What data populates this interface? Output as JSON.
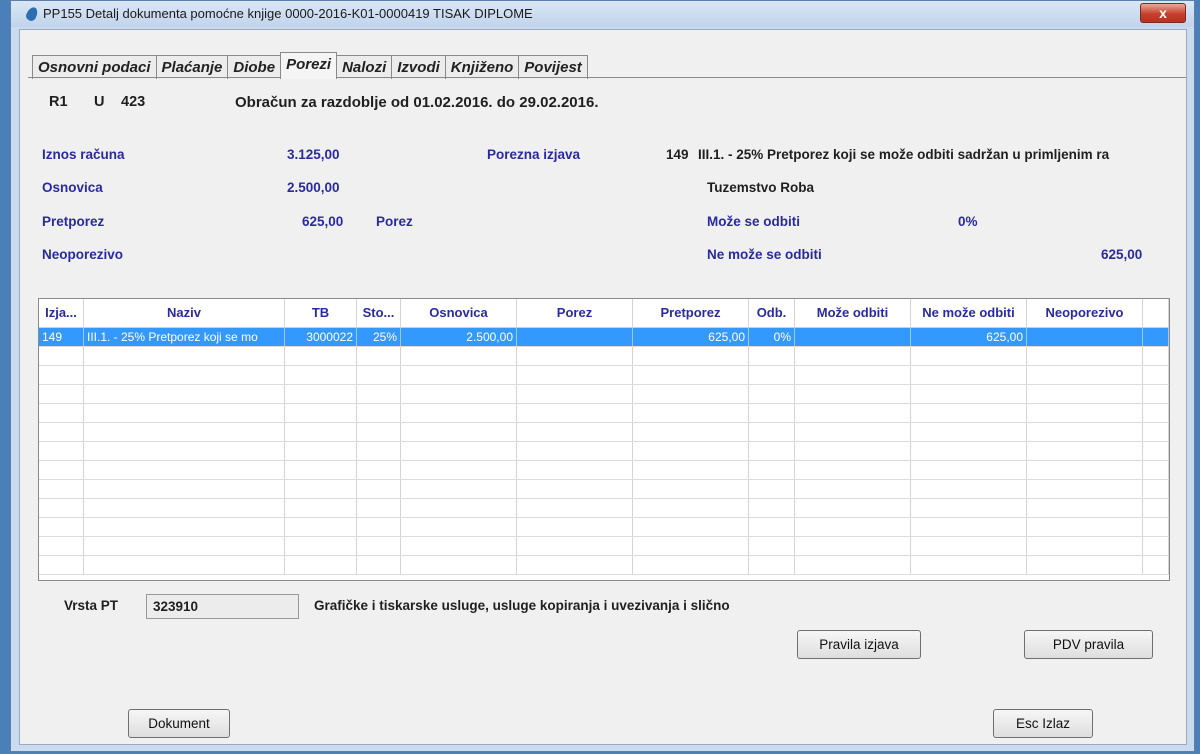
{
  "window": {
    "title": "PP155 Detalj dokumenta pomoćne knjige 0000-2016-K01-0000419 TISAK DIPLOME",
    "close_label": "x"
  },
  "tabs": [
    {
      "label": "Osnovni podaci"
    },
    {
      "label": "Plaćanje"
    },
    {
      "label": "Diobe"
    },
    {
      "label": "Porezi",
      "active": true
    },
    {
      "label": "Nalozi"
    },
    {
      "label": "Izvodi"
    },
    {
      "label": "Knjiženo"
    },
    {
      "label": "Povijest"
    }
  ],
  "header": {
    "code1": "R1",
    "code2": "U",
    "code3": "423",
    "period": "Obračun za razdoblje od 01.02.2016. do 29.02.2016."
  },
  "summary": {
    "iznos_label": "Iznos računa",
    "iznos_value": "3.125,00",
    "osnovica_label": "Osnovica",
    "osnovica_value": "2.500,00",
    "pretporez_label": "Pretporez",
    "pretporez_value": "625,00",
    "porez_label": "Porez",
    "neoporezivo_label": "Neoporezivo",
    "porezna_izjava_label": "Porezna izjava",
    "porezna_izjava_code": "149",
    "porezna_izjava_text": "III.1. - 25% Pretporez koji se može odbiti sadržan u primljenim ra",
    "tuzemstvo": "Tuzemstvo Roba",
    "moze_label": "Može se odbiti",
    "moze_value": "0%",
    "ne_moze_label": "Ne može se odbiti",
    "ne_moze_value": "625,00"
  },
  "grid": {
    "columns": [
      "Izja...",
      "Naziv",
      "TB",
      "Sto...",
      "Osnovica",
      "Porez",
      "Pretporez",
      "Odb.",
      "Može odbiti",
      "Ne može odbiti",
      "Neoporezivo"
    ],
    "rows": [
      {
        "izjava": "149",
        "naziv": "III.1. - 25% Pretporez koji se mo",
        "tb": "3000022",
        "stopa": "25%",
        "osnovica": "2.500,00",
        "porez": "",
        "pretporez": "625,00",
        "odb": "0%",
        "moze": "",
        "ne_moze": "625,00",
        "neoporezivo": ""
      }
    ]
  },
  "vrsta_pt": {
    "label": "Vrsta PT",
    "value": "323910",
    "description": "Grafičke i tiskarske usluge, usluge kopiranja i uvezivanja i slično"
  },
  "buttons": {
    "pravila_izjava": "Pravila izjava",
    "pdv_pravila": "PDV pravila",
    "dokument": "Dokument",
    "izlaz": "Esc Izlaz"
  }
}
